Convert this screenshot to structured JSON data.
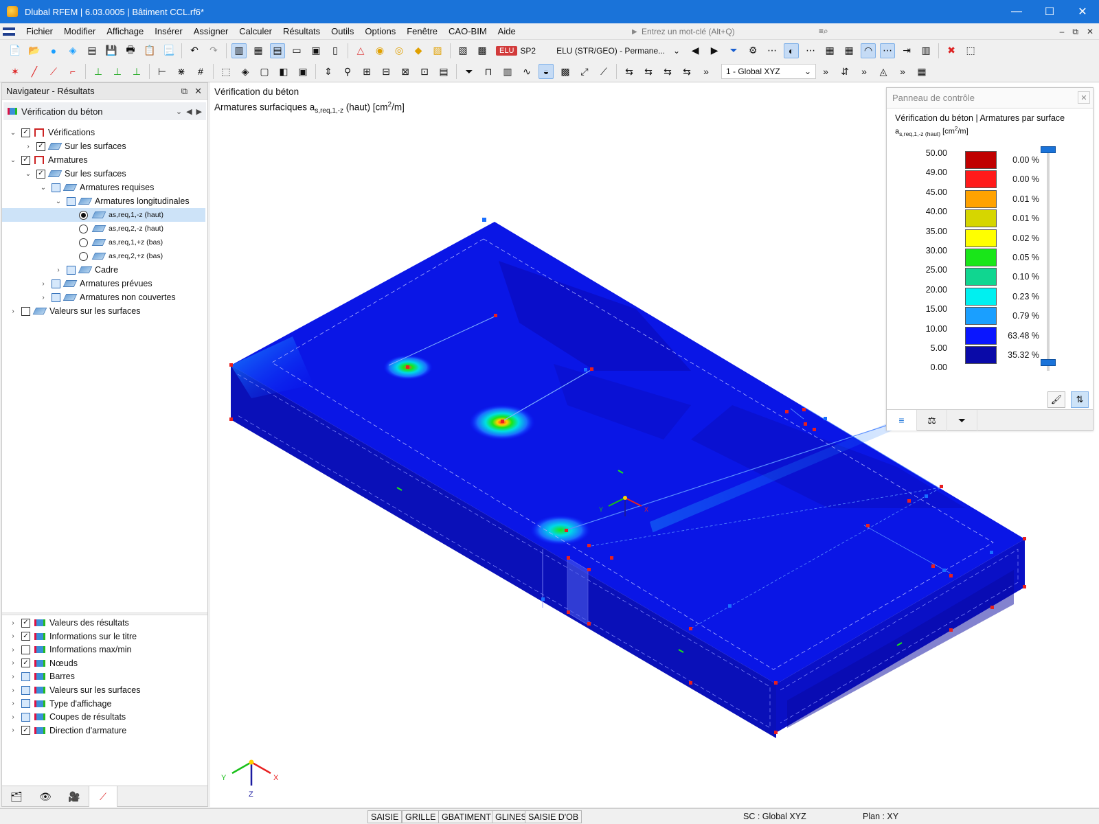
{
  "window": {
    "title": "Dlubal RFEM | 6.03.0005 | Bâtiment CCL.rf6*",
    "controls": [
      "—",
      "☐",
      "✕"
    ]
  },
  "menu": {
    "items": [
      "Fichier",
      "Modifier",
      "Affichage",
      "Insérer",
      "Assigner",
      "Calculer",
      "Résultats",
      "Outils",
      "Options",
      "Fenêtre",
      "CAO-BIM",
      "Aide"
    ],
    "search_placeholder": "Entrez un mot-clé (Alt+Q)",
    "right_controls": [
      "–",
      "⧉",
      "✕"
    ]
  },
  "toolbar": {
    "load_case_badge": "ELU",
    "load_case_name": "SP2",
    "combination": "ELU (STR/GEO) - Permane...",
    "view": "1 - Global XYZ"
  },
  "navigator": {
    "title": "Navigateur - Résultats",
    "selector": "Vérification du béton",
    "tree": [
      {
        "label": "Vérifications",
        "level": 0,
        "expand": "open",
        "check": "checked",
        "icon": "check"
      },
      {
        "label": "Sur les surfaces",
        "level": 1,
        "expand": "closed",
        "check": "checked",
        "icon": "surf"
      },
      {
        "label": "Armatures",
        "level": 0,
        "expand": "open",
        "check": "checked",
        "icon": "check"
      },
      {
        "label": "Sur les surfaces",
        "level": 1,
        "expand": "open",
        "check": "checked",
        "icon": "surf"
      },
      {
        "label": "Armatures requises",
        "level": 2,
        "expand": "open",
        "check": "partial",
        "icon": "surf"
      },
      {
        "label": "Armatures longitudinales",
        "level": 3,
        "expand": "open",
        "check": "partial",
        "icon": "surf"
      },
      {
        "label": "as,req,1,-z (haut)",
        "level": 4,
        "radio": "on",
        "icon": "surf",
        "selected": true
      },
      {
        "label": "as,req,2,-z (haut)",
        "level": 4,
        "radio": "off",
        "icon": "surf"
      },
      {
        "label": "as,req,1,+z (bas)",
        "level": 4,
        "radio": "off",
        "icon": "surf"
      },
      {
        "label": "as,req,2,+z (bas)",
        "level": 4,
        "radio": "off",
        "icon": "surf"
      },
      {
        "label": "Cadre",
        "level": 3,
        "expand": "closed",
        "check": "partial",
        "icon": "surf"
      },
      {
        "label": "Armatures prévues",
        "level": 2,
        "expand": "closed",
        "check": "partial",
        "icon": "surf"
      },
      {
        "label": "Armatures non couvertes",
        "level": 2,
        "expand": "closed",
        "check": "partial",
        "icon": "surf"
      },
      {
        "label": "Valeurs sur les surfaces",
        "level": 0,
        "expand": "closed",
        "check": "empty",
        "icon": "surf"
      }
    ],
    "bottom_tree": [
      {
        "label": "Valeurs des résultats",
        "check": "checked"
      },
      {
        "label": "Informations sur le titre",
        "check": "checked"
      },
      {
        "label": "Informations max/min",
        "check": "empty"
      },
      {
        "label": "Nœuds",
        "check": "checked"
      },
      {
        "label": "Barres",
        "check": "partial"
      },
      {
        "label": "Valeurs sur les surfaces",
        "check": "partial"
      },
      {
        "label": "Type d'affichage",
        "check": "partial"
      },
      {
        "label": "Coupes de résultats",
        "check": "partial"
      },
      {
        "label": "Direction d'armature",
        "check": "checked"
      }
    ]
  },
  "viewport": {
    "heading": "Vérification du béton",
    "subheading_prefix": "Armatures surfaciques a",
    "subheading_sub": "s,req,1,-z",
    "subheading_suffix": " (haut) [cm",
    "subheading_sup": "2",
    "subheading_end": "/m]",
    "axes": {
      "x": "X",
      "y": "Y",
      "z": "Z"
    }
  },
  "control_panel": {
    "title": "Panneau de contrôle",
    "subtitle": "Vérification du béton | Armatures par surface",
    "quantity_sym": "a",
    "quantity_sub": "s,req,1,-z (haut)",
    "quantity_unit_pre": " [cm",
    "quantity_unit_sup": "2",
    "quantity_unit_post": "/m]",
    "legend": {
      "values": [
        "50.00",
        "49.00",
        "45.00",
        "40.00",
        "35.00",
        "30.00",
        "25.00",
        "20.00",
        "15.00",
        "10.00",
        "5.00",
        "0.00"
      ],
      "colors": [
        "#c00000",
        "#ff1a1a",
        "#ffa200",
        "#d6d600",
        "#ffff00",
        "#19e619",
        "#10d690",
        "#00f0f0",
        "#1a9fff",
        "#0a16ff",
        "#0a0aa8"
      ],
      "percents": [
        "0.00 %",
        "0.00 %",
        "0.01 %",
        "0.01 %",
        "0.02 %",
        "0.05 %",
        "0.10 %",
        "0.23 %",
        "0.79 %",
        "63.48 %",
        "35.32 %"
      ]
    }
  },
  "statusbar": {
    "buttons": [
      "SAISIE",
      "GRILLE",
      "GBATIMENT",
      "GLINES",
      "SAISIE D'OB"
    ],
    "sc": "SC : Global XYZ",
    "plane": "Plan : XY"
  }
}
